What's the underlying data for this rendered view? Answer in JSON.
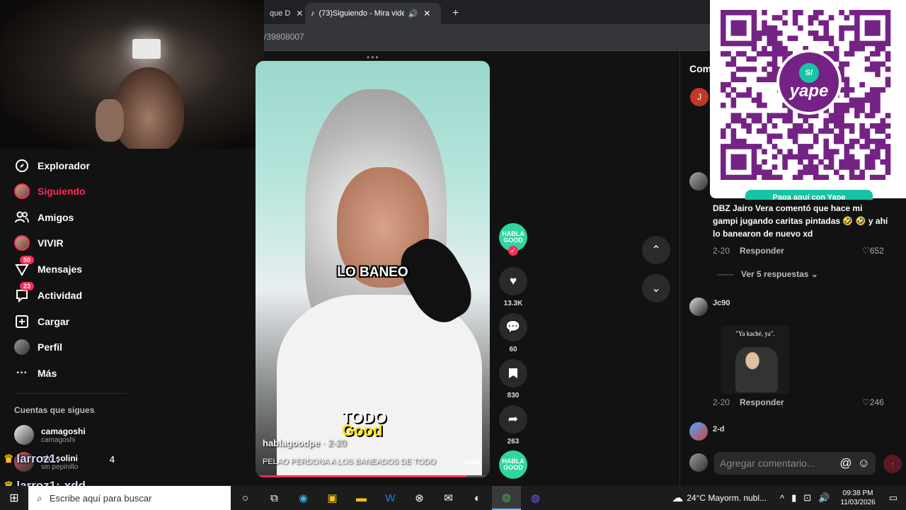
{
  "browser": {
    "tabs": [
      {
        "label": "que D",
        "close": "✕"
      },
      {
        "label": "(73)Siguiendo - Mira videos",
        "close": "✕",
        "sound": "🔊"
      }
    ],
    "new_tab": "+",
    "url_fragment": "/39808007"
  },
  "sidebar": {
    "items": [
      {
        "label": "Explorador",
        "icon": "compass-icon"
      },
      {
        "label": "Siguiendo",
        "icon": "following-avatar-icon",
        "active": true
      },
      {
        "label": "Amigos",
        "icon": "friends-icon"
      },
      {
        "label": "VIVIR",
        "icon": "live-icon"
      },
      {
        "label": "Mensajes",
        "icon": "messages-icon",
        "badge": "50"
      },
      {
        "label": "Actividad",
        "icon": "activity-icon",
        "badge": "23"
      },
      {
        "label": "Cargar",
        "icon": "upload-icon"
      },
      {
        "label": "Perfil",
        "icon": "profile-avatar-icon"
      },
      {
        "label": "Más",
        "icon": "more-icon"
      }
    ],
    "following_title": "Cuentas que sigues",
    "following": [
      {
        "name": "camagoshi",
        "sub": "camagoshi"
      },
      {
        "name": "alo solini",
        "sub": "sin pepinillo"
      }
    ]
  },
  "chat_overlay": [
    {
      "user": "larroz1:",
      "msg": "4"
    },
    {
      "user": "larroz1:",
      "msg": "xdd"
    }
  ],
  "video": {
    "caption": "LO BANEO",
    "logo_line1": "TODO",
    "logo_line2": "Good",
    "author": "hablagoodpe",
    "date": "· 2-20",
    "description": "PELAO PERDONA A LOS BANEADOS DE TODO",
    "more": "más",
    "progress": 0.9
  },
  "actions": {
    "author_logo": "HABLA GOOD",
    "likes": "13.3K",
    "comments": "60",
    "saves": "830",
    "shares": "263"
  },
  "comments": {
    "title": "Com",
    "first_initial": "J",
    "list": [
      {
        "text": "DBZ Jairo Vera comentó que hace mi gampi jugando caritas pintadas 🤣 🤣 y ahí lo banearon de nuevo xd",
        "date": "2-20",
        "reply": "Responder",
        "likes": "652"
      },
      {
        "name": "Jc90",
        "meme_caption": "\"Ya kaché, ya\".",
        "date": "2-20",
        "reply": "Responder",
        "likes": "246"
      },
      {
        "name": "2-d"
      }
    ],
    "view_replies": "Ver 5 respuestas",
    "input_placeholder": "Agregar comentario...",
    "at": "@",
    "emoji": "☺"
  },
  "qr": {
    "badge": "S/",
    "brand": "yape",
    "bottom_text": "Paga aquí con Yape"
  },
  "taskbar": {
    "search_placeholder": "Escribe aquí para buscar",
    "weather": "24°C  Mayorm. nubl...",
    "time": "09:38 PM",
    "date": "11/03/2026"
  }
}
